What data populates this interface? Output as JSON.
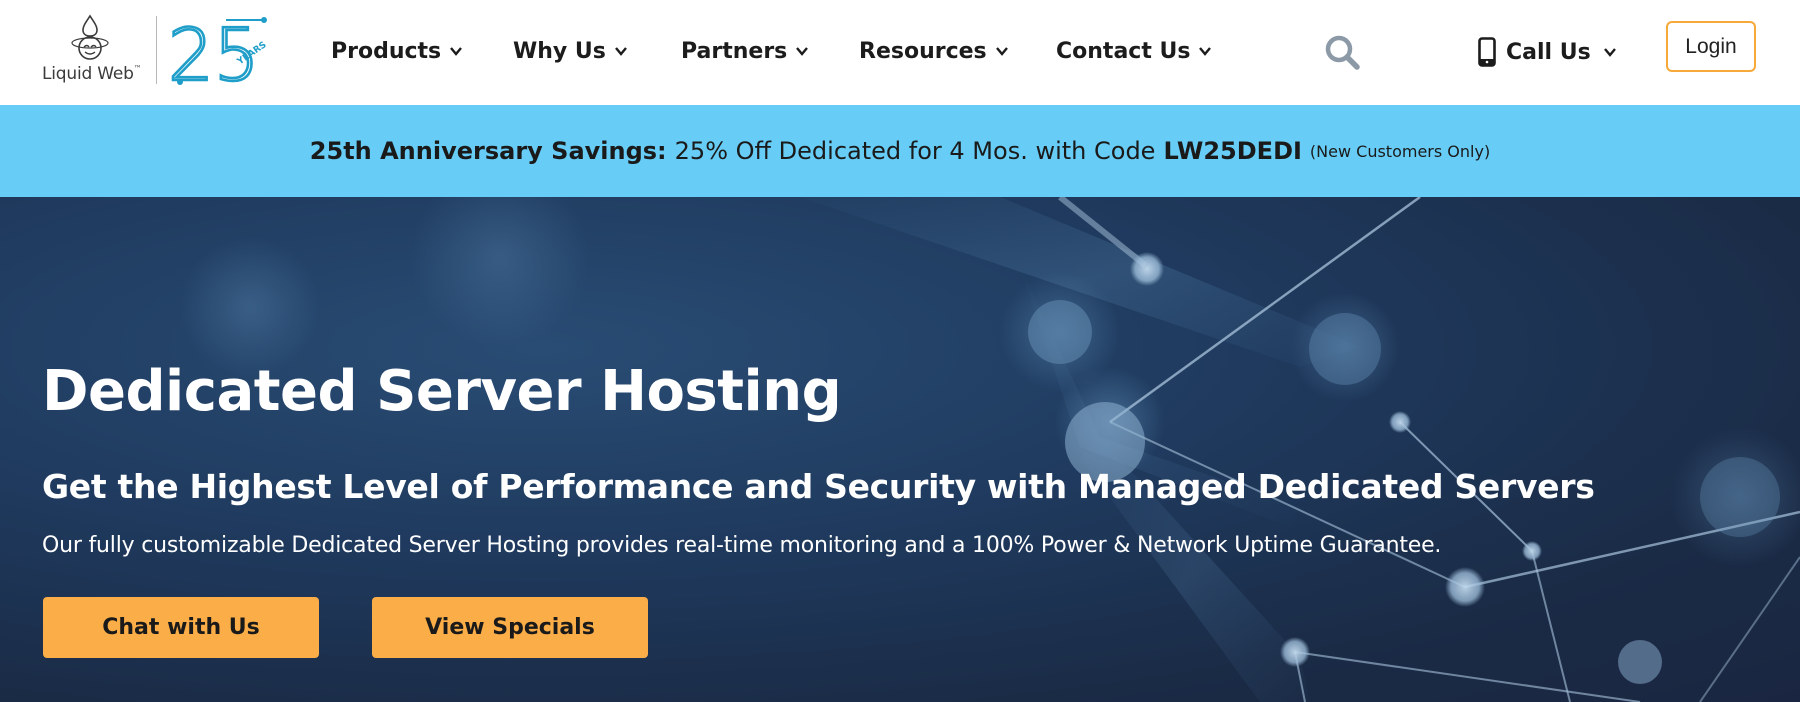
{
  "header": {
    "logo": {
      "word": "Liquid Web",
      "trademark": "™",
      "anniversary_number": "25",
      "anniversary_word": "YEARS"
    },
    "nav": [
      {
        "label": "Products"
      },
      {
        "label": "Why Us"
      },
      {
        "label": "Partners"
      },
      {
        "label": "Resources"
      },
      {
        "label": "Contact Us"
      }
    ],
    "search_icon": "search-icon",
    "call_label": "Call Us",
    "login_label": "Login"
  },
  "promo": {
    "bold_lead": "25th Anniversary Savings:",
    "text": "25% Off Dedicated for 4 Mos. with Code",
    "code": "LW25DEDI",
    "small": "(New Customers Only)"
  },
  "hero": {
    "title": "Dedicated Server Hosting",
    "subtitle": "Get the Highest Level of Performance and Security with Managed Dedicated Servers",
    "description": "Our fully customizable Dedicated Server Hosting provides real-time monitoring and a 100% Power & Network Uptime Guarantee.",
    "buttons": [
      {
        "label": "Chat with Us"
      },
      {
        "label": "View Specials"
      }
    ]
  },
  "colors": {
    "promo_bg": "#67cdf6",
    "hero_bg": "#1f3a5e",
    "button_bg": "#fbad47",
    "login_border": "#f7a93a",
    "logo_blue": "#1f9ec9"
  }
}
